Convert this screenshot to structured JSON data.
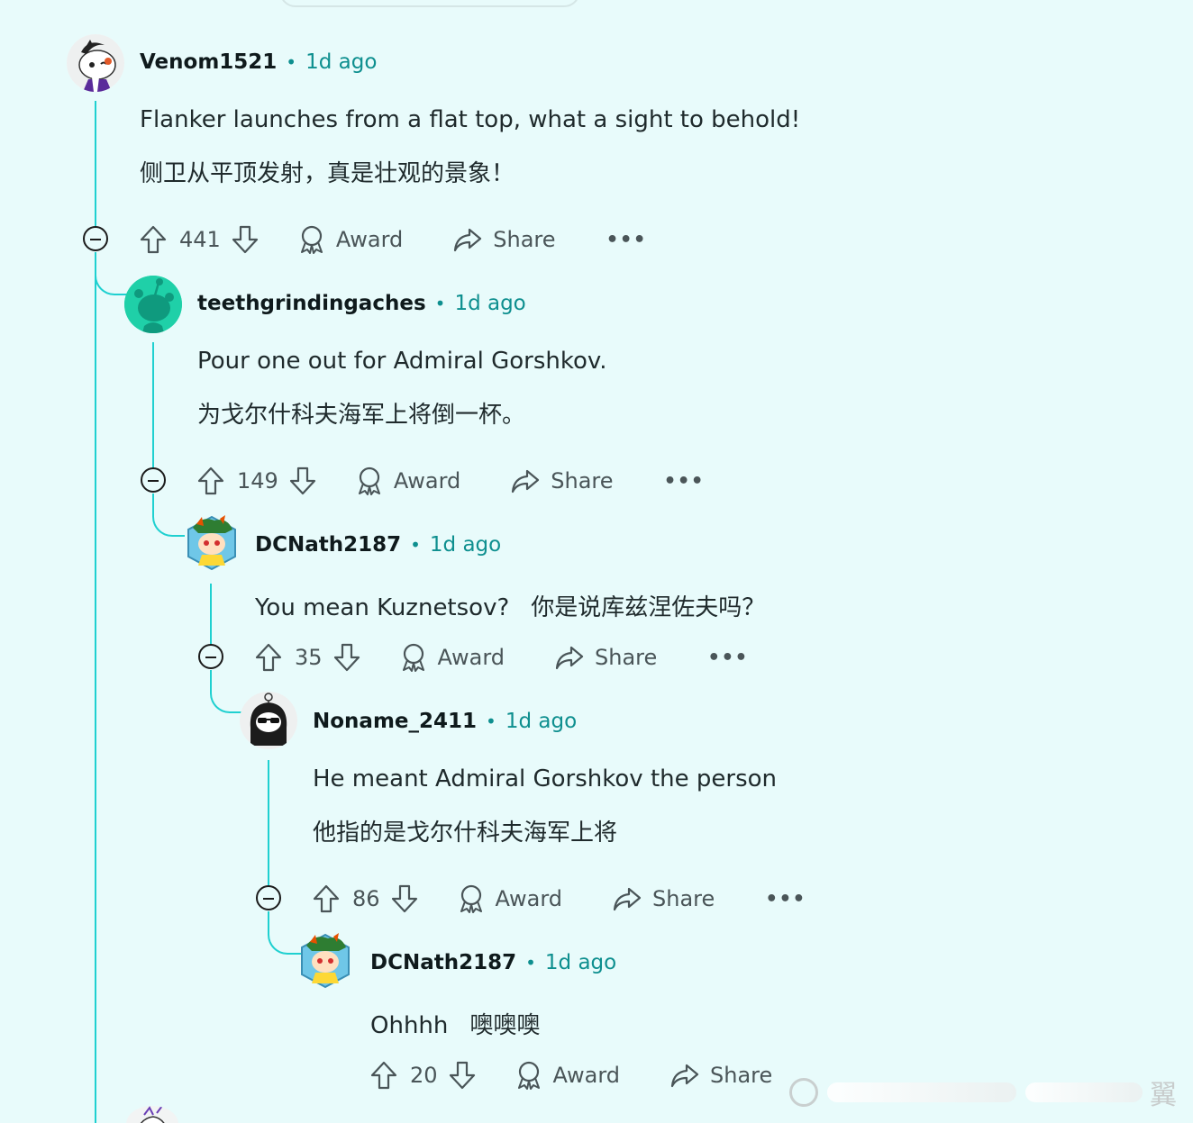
{
  "comments": [
    {
      "username": "Venom1521",
      "time": "1d ago",
      "text_en": "Flanker launches from a flat top, what a sight to behold!",
      "text_zh": "侧卫从平顶发射，真是壮观的景象！",
      "votes": "441",
      "avatar_icon": "snoo-avatar-icon"
    },
    {
      "username": "teethgrindingaches",
      "time": "1d ago",
      "text_en": "Pour one out for Admiral Gorshkov.",
      "text_zh": "为戈尔什科夫海军上将倒一杯。",
      "votes": "149",
      "avatar_icon": "default-snoo-avatar-icon"
    },
    {
      "username": "DCNath2187",
      "time": "1d ago",
      "text_en": "You mean Kuznetsov?",
      "text_zh": "你是说库兹涅佐夫吗？",
      "votes": "35",
      "avatar_icon": "hex-snoo-avatar-icon"
    },
    {
      "username": "Noname_2411",
      "time": "1d ago",
      "text_en": "He meant Admiral Gorshkov the person",
      "text_zh": "他指的是戈尔什科夫海军上将",
      "votes": "86",
      "avatar_icon": "sunglasses-snoo-avatar-icon"
    },
    {
      "username": "DCNath2187",
      "time": "1d ago",
      "text_en": "Ohhhh",
      "text_zh": "噢噢噢",
      "votes": "20",
      "avatar_icon": "hex-snoo-avatar-icon"
    }
  ],
  "labels": {
    "award": "Award",
    "share": "Share",
    "more": "•••",
    "separator": "•"
  },
  "watermark": {
    "text": "翼"
  },
  "colors": {
    "background": "#e8fbfb",
    "thread_line": "#1fd0d0",
    "time": "#0e8f8f"
  }
}
